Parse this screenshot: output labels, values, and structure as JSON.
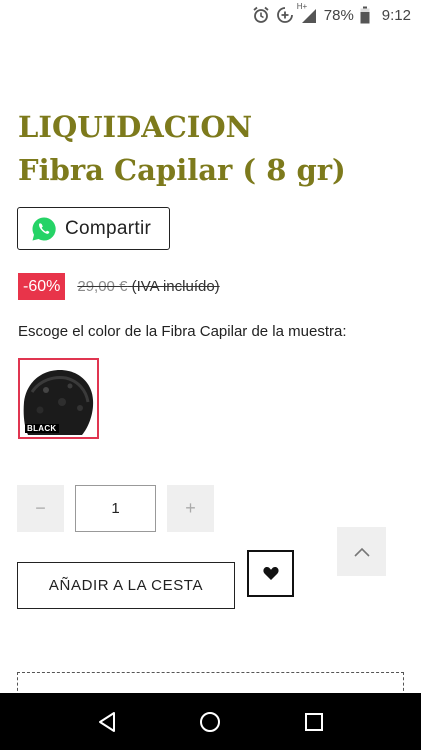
{
  "status_bar": {
    "icons": [
      "alarm-icon",
      "data-saver-icon",
      "signal-icon",
      "battery-icon"
    ],
    "network_label": "H+",
    "battery_percent": "78%",
    "time": "9:12"
  },
  "product": {
    "title_line1": "LIQUIDACION",
    "title_line2": "Fibra Capilar ( 8 gr)",
    "title_color": "#7d7a1c"
  },
  "share": {
    "label": "Compartir",
    "icon": "whatsapp-icon",
    "icon_color": "#25d366"
  },
  "price": {
    "discount": "-60%",
    "discount_color": "#e8344a",
    "old_price": "29,00 €",
    "tax_note": "(IVA incluído)"
  },
  "color_chooser": {
    "label": "Escoge el color de la Fibra Capilar de la muestra:",
    "swatches": [
      {
        "caption": "BLACK",
        "selected": true
      }
    ],
    "selected_border_color": "#e03550"
  },
  "quantity": {
    "minus": "−",
    "plus": "+",
    "value": "1"
  },
  "actions": {
    "add_to_cart": "AÑADIR A LA CESTA",
    "wishlist_icon": "heart-icon",
    "scroll_top_icon": "chevron-up-icon"
  },
  "nav_bar": {
    "icons": [
      "back-icon",
      "home-icon",
      "recents-icon"
    ]
  }
}
